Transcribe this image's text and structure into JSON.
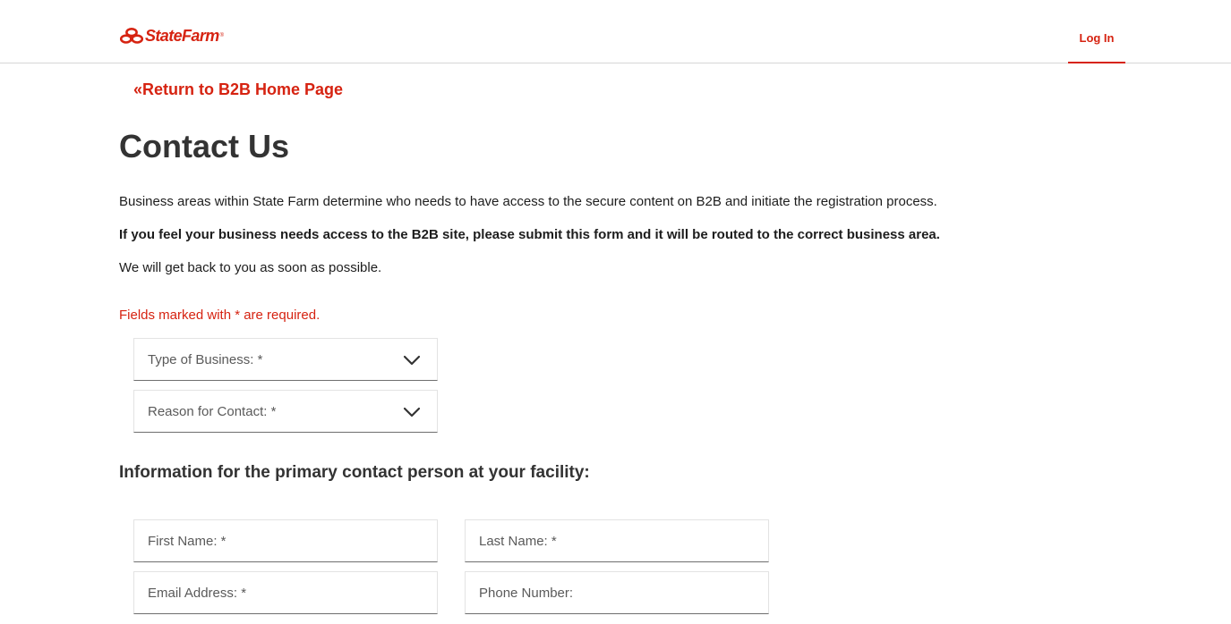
{
  "header": {
    "logo_text": "StateFarm",
    "logo_reg": "®",
    "login_label": "Log In"
  },
  "back_link": {
    "label": "«Return to B2B Home Page"
  },
  "page": {
    "title": "Contact Us",
    "paragraph_1": "Business areas within State Farm determine who needs to have access to the secure content on B2B and initiate the registration process.",
    "paragraph_2": "If you feel your business needs access to the B2B site, please submit this form and it will be routed to the correct business area.",
    "paragraph_3": "We will get back to you as soon as possible.",
    "required_note": "Fields marked with * are required."
  },
  "form": {
    "type_of_business_label": "Type of Business: *",
    "reason_for_contact_label": "Reason for Contact: *",
    "section_heading": "Information for the primary contact person at your facility:",
    "first_name_label": "First Name: *",
    "last_name_label": "Last Name: *",
    "email_label": "Email Address: *",
    "phone_label": "Phone Number:"
  },
  "colors": {
    "brand_red": "#d62311",
    "text_dark": "#333333"
  },
  "icons": {
    "logo": "state-farm-ovals-icon",
    "dropdown": "chevron-down-icon"
  }
}
